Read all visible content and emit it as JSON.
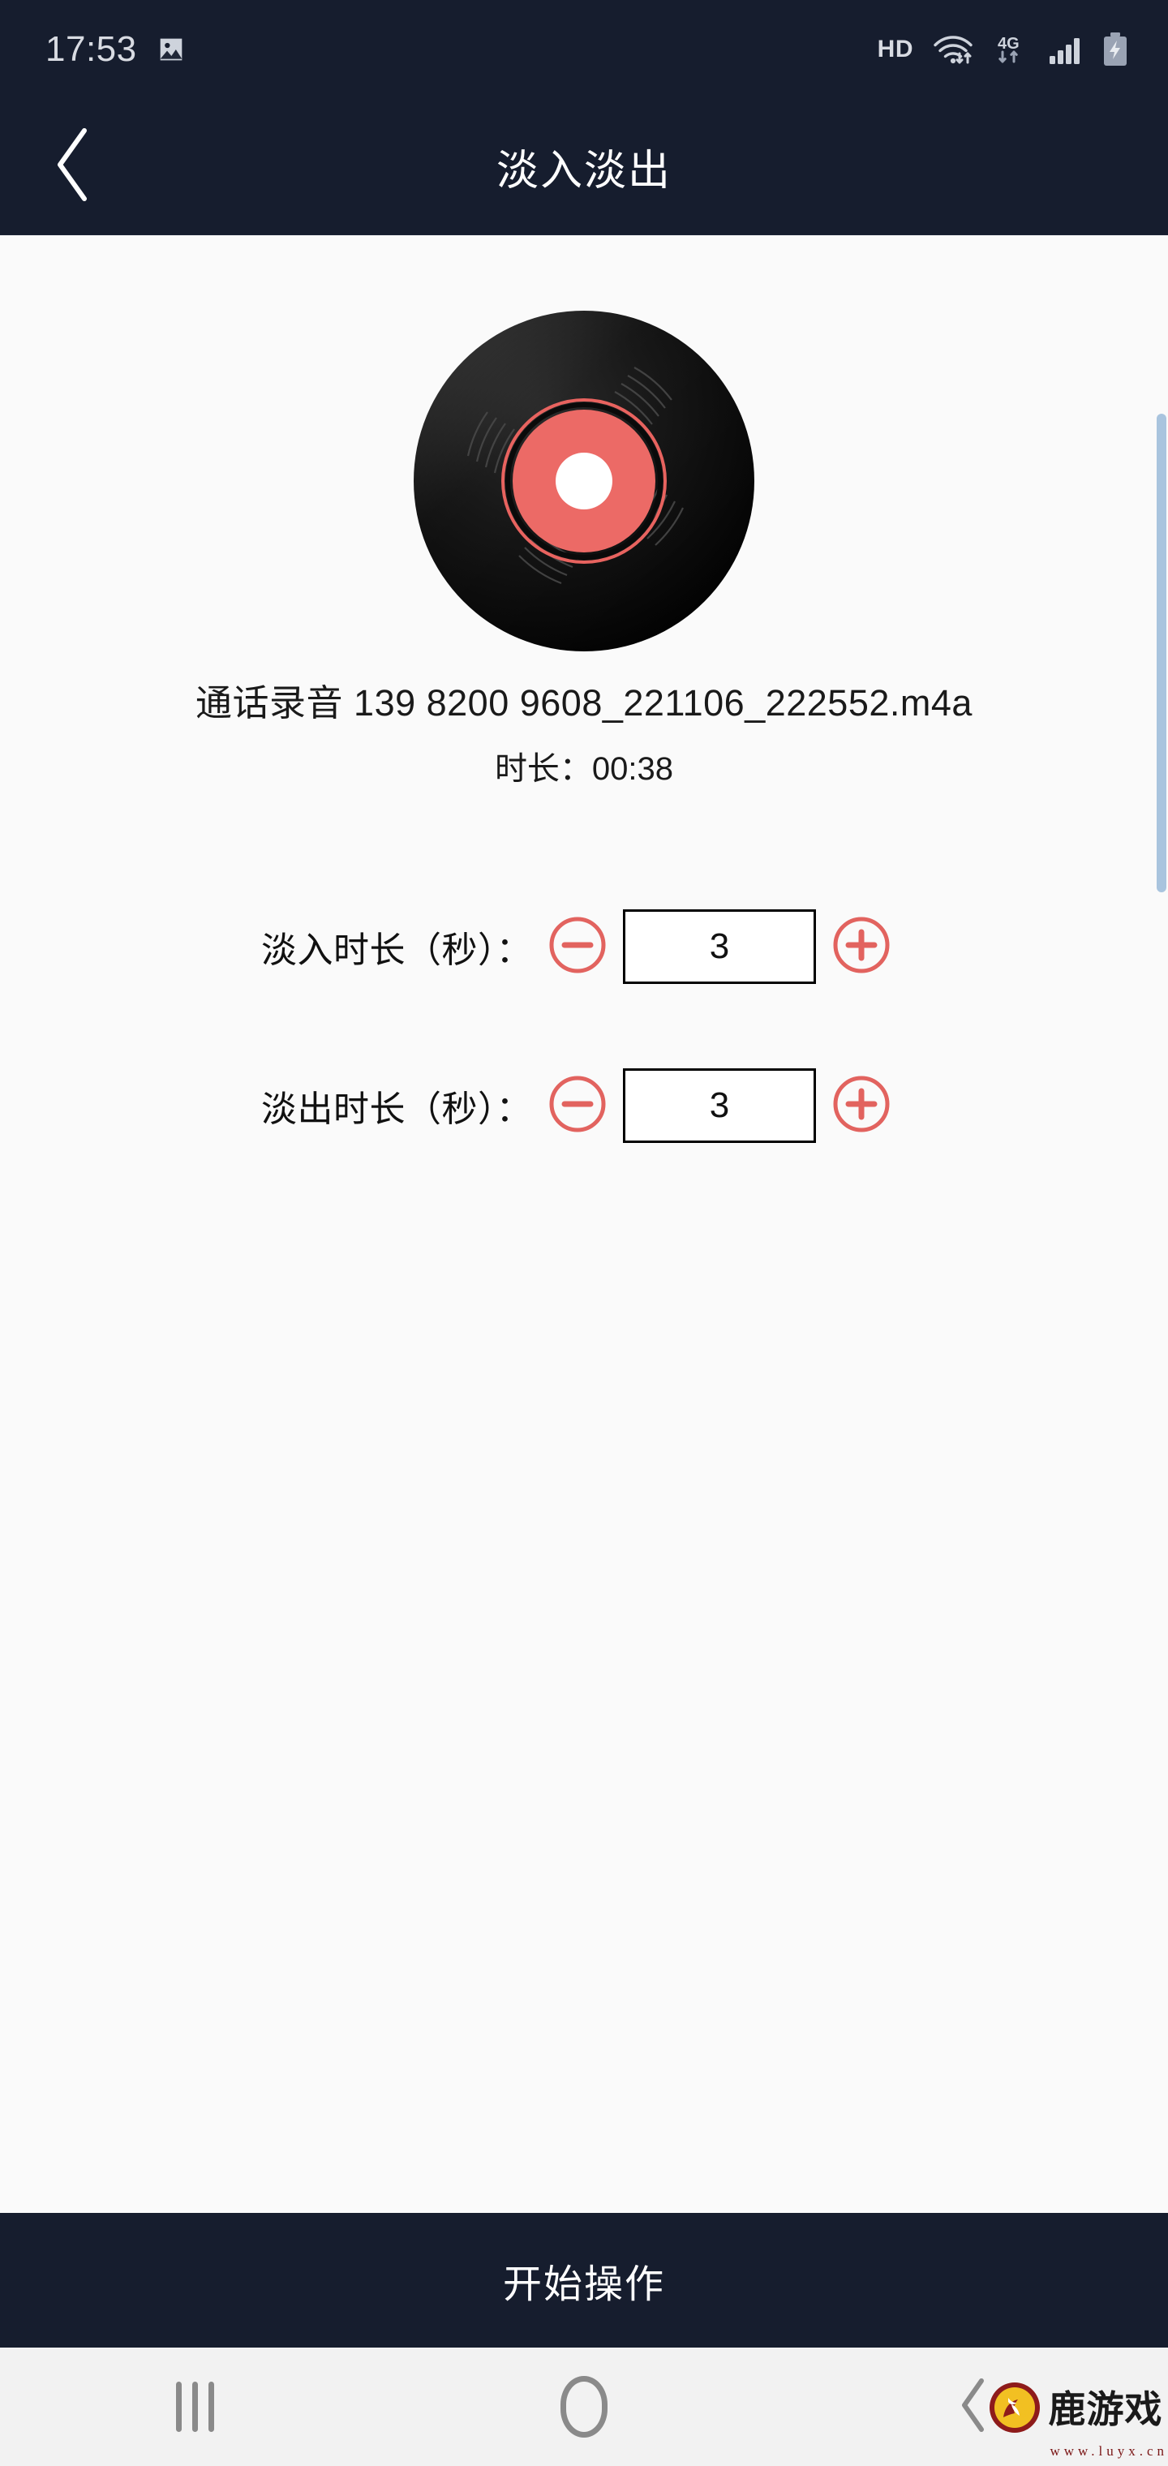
{
  "status_bar": {
    "time": "17:53",
    "photo_icon": "image-icon",
    "hd_label": "HD",
    "wifi_icon": "wifi-icon",
    "network_label": "4G",
    "signal_icon": "cellular-signal-icon",
    "battery_icon": "battery-charging-icon"
  },
  "header": {
    "back_icon": "back-chevron-icon",
    "title": "淡入淡出",
    "background_color": "#161d2e"
  },
  "media": {
    "artwork_icon": "vinyl-record-icon",
    "filename": "通话录音 139 8200 9608_221106_222552.m4a",
    "duration_text": "时长：00:38",
    "disc_outer_color": "#0d0d0d",
    "disc_label_color": "#e8635f",
    "disc_hole_color": "#ffffff"
  },
  "controls": {
    "accent_color": "#e2635f",
    "fade_in": {
      "label": "淡入时长（秒）：",
      "decrement_icon": "minus-circle-icon",
      "value": "3",
      "placeholder": "0",
      "increment_icon": "plus-circle-icon"
    },
    "fade_out": {
      "label": "淡出时长（秒）：",
      "decrement_icon": "minus-circle-icon",
      "value": "3",
      "placeholder": "0",
      "increment_icon": "plus-circle-icon"
    }
  },
  "action_bar": {
    "label": "开始操作",
    "background_color": "#161d2e"
  },
  "nav_bar": {
    "recents_icon": "recents-icon",
    "home_icon": "home-icon",
    "back_icon": "back-chevron-icon"
  },
  "watermark": {
    "brand": "鹿游戏",
    "url": "www.luyx.cn",
    "logo_icon": "deer-logo-icon"
  }
}
